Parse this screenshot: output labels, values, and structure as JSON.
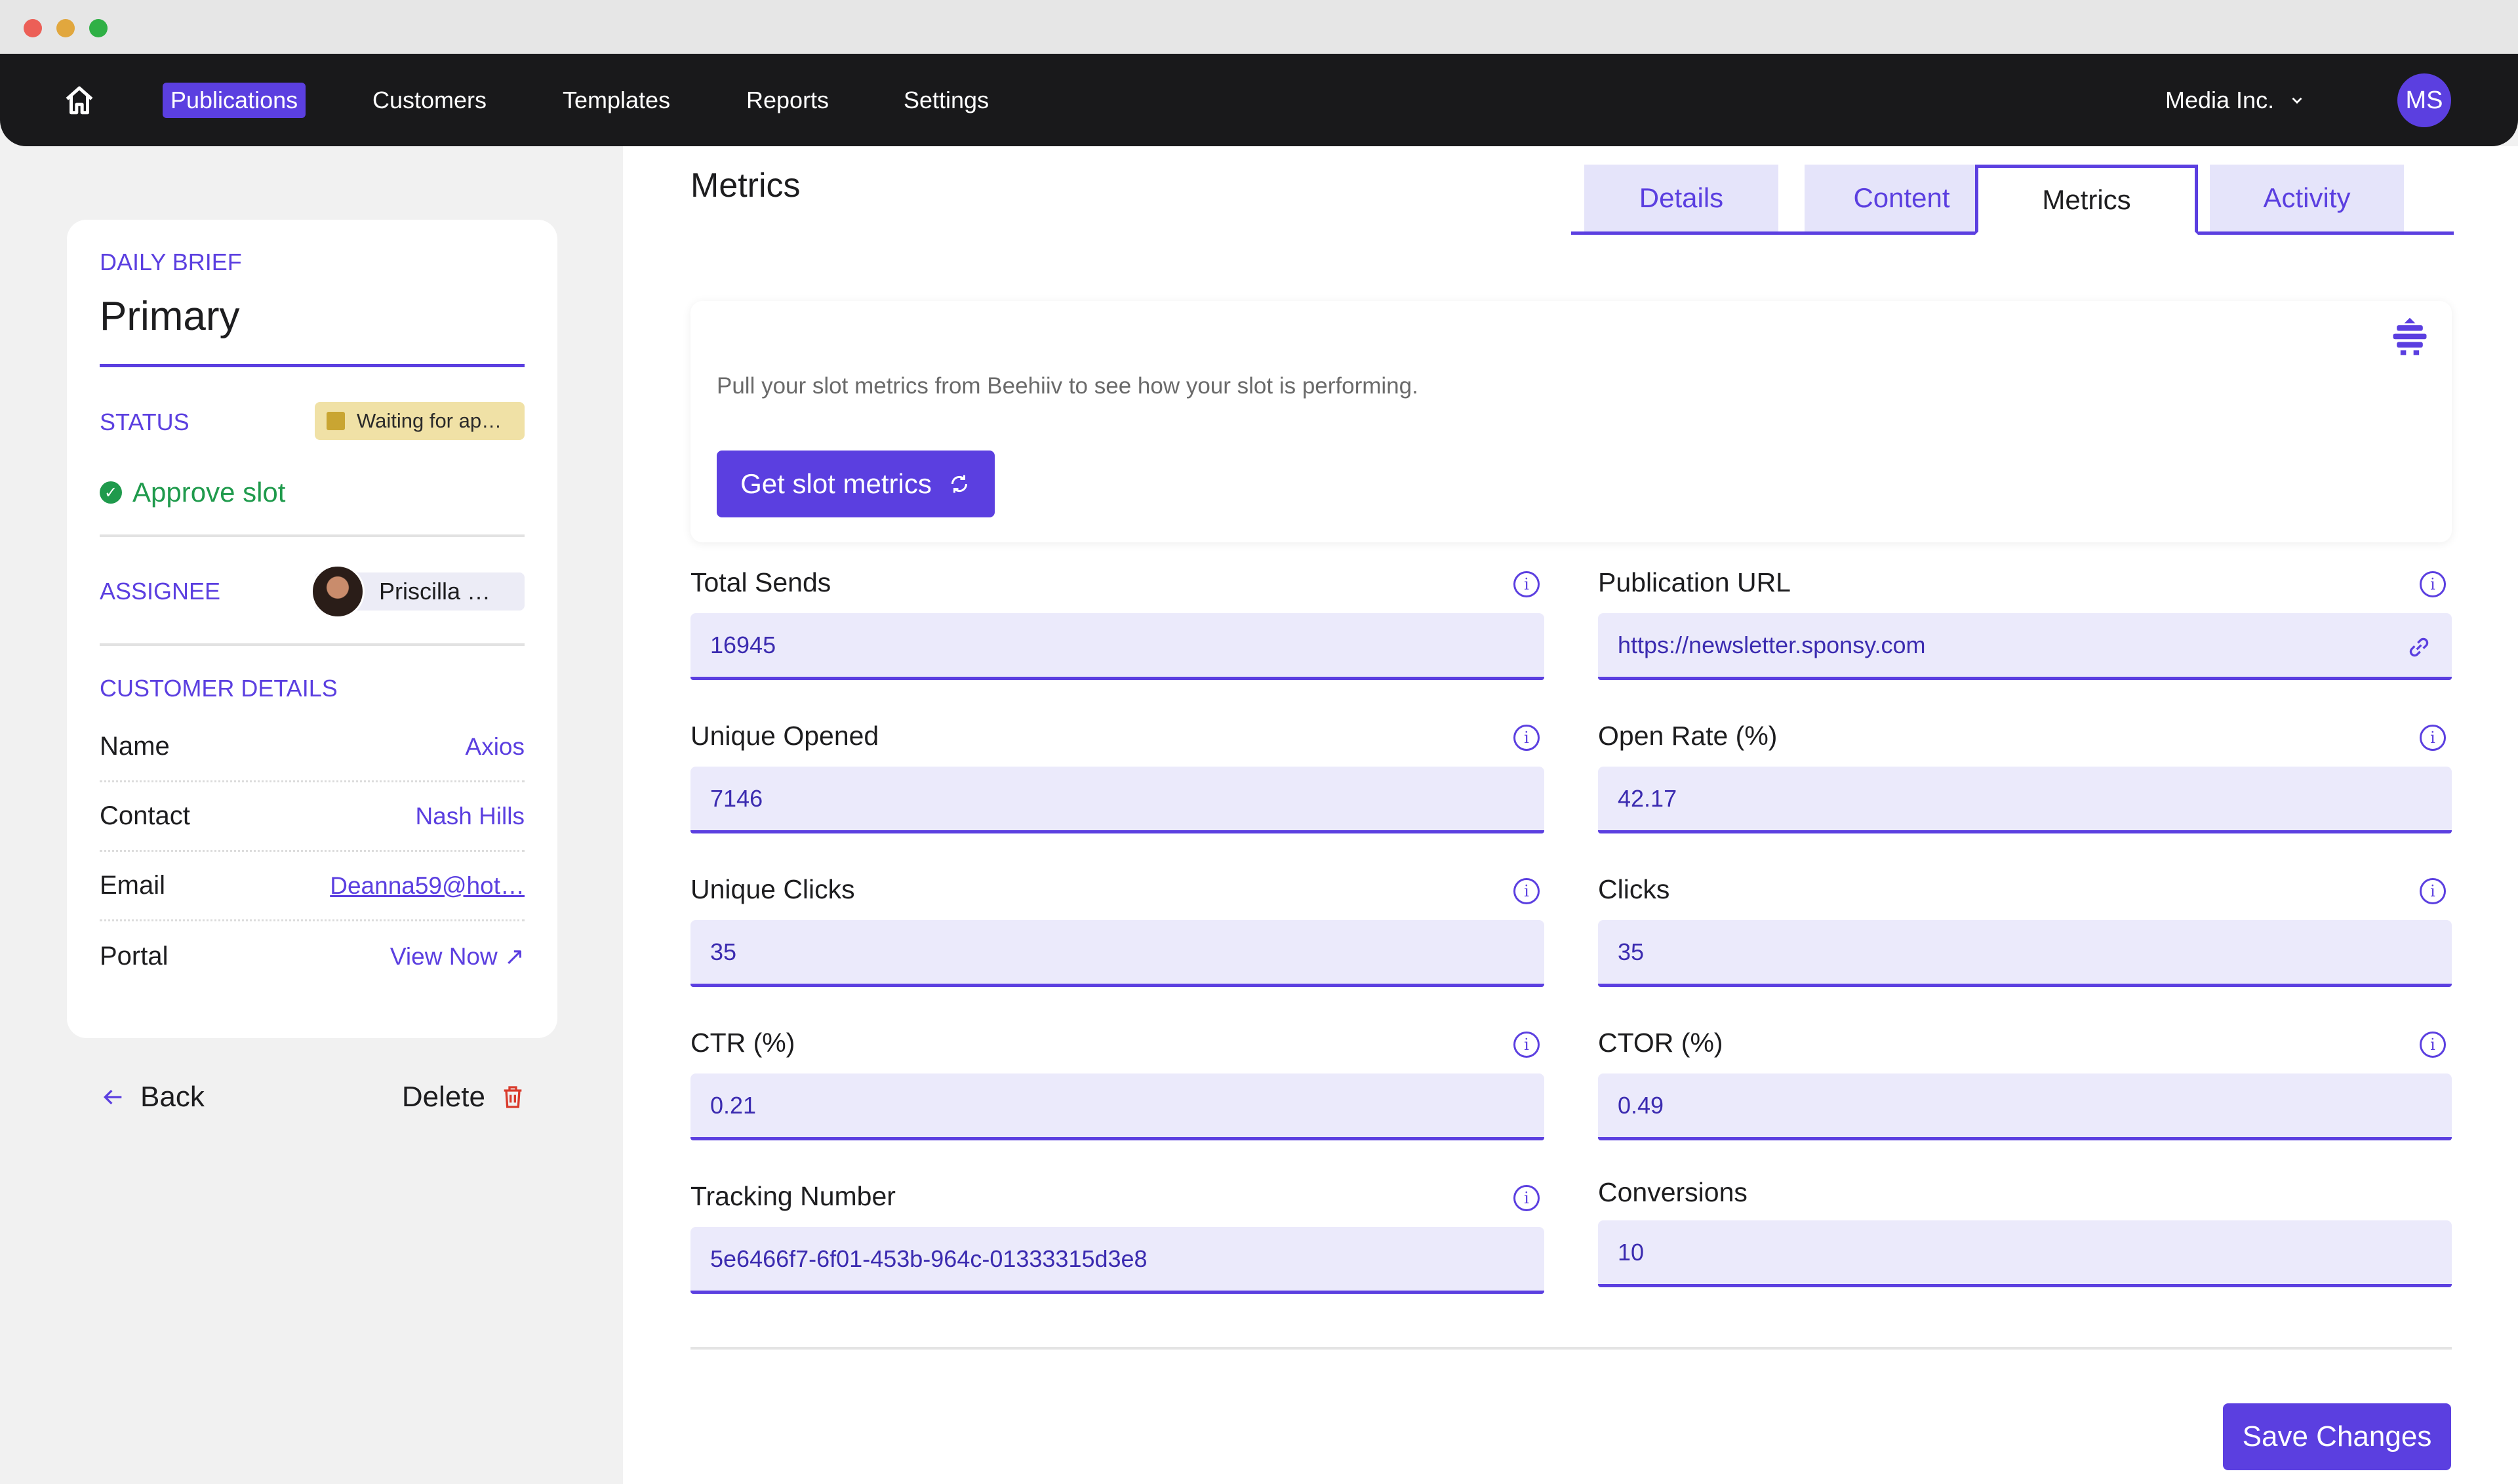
{
  "nav": {
    "items": [
      "Publications",
      "Customers",
      "Templates",
      "Reports",
      "Settings"
    ],
    "org": "Media Inc.",
    "user_initials": "MS"
  },
  "sidebar": {
    "category": "DAILY BRIEF",
    "title": "Primary",
    "status_label": "STATUS",
    "status_value": "Waiting for ap…",
    "approve": "Approve slot",
    "assignee_label": "ASSIGNEE",
    "assignee_name": "Priscilla …",
    "customer_label": "CUSTOMER DETAILS",
    "details": [
      {
        "key": "Name",
        "value": "Axios"
      },
      {
        "key": "Contact",
        "value": "Nash Hills"
      },
      {
        "key": "Email",
        "value": "Deanna59@hot…"
      },
      {
        "key": "Portal",
        "value": "View Now ↗"
      }
    ],
    "back": "Back",
    "delete": "Delete"
  },
  "main": {
    "title": "Metrics",
    "tabs": [
      "Details",
      "Content",
      "Metrics",
      "Activity"
    ],
    "active_tab": "Metrics",
    "beehiiv_text": "Pull your slot metrics from Beehiiv to see how your slot is performing.",
    "beehiiv_button": "Get slot metrics",
    "fields": {
      "total_sends": {
        "label": "Total Sends",
        "value": "16945"
      },
      "publication_url": {
        "label": "Publication URL",
        "value": "https://newsletter.sponsy.com"
      },
      "unique_opened": {
        "label": "Unique Opened",
        "value": "7146"
      },
      "open_rate": {
        "label": "Open Rate (%)",
        "value": "42.17"
      },
      "unique_clicks": {
        "label": "Unique Clicks",
        "value": "35"
      },
      "clicks": {
        "label": "Clicks",
        "value": "35"
      },
      "ctr": {
        "label": "CTR (%)",
        "value": "0.21"
      },
      "ctor": {
        "label": "CTOR (%)",
        "value": "0.49"
      },
      "tracking_number": {
        "label": "Tracking Number",
        "value": "5e6466f7-6f01-453b-964c-01333315d3e8"
      },
      "conversions": {
        "label": "Conversions",
        "value": "10"
      }
    },
    "save": "Save Changes"
  },
  "colors": {
    "accent": "#5b3fe0",
    "nav_bg": "#19191b",
    "input_bg": "#ebeafb",
    "status_bg": "#f0e1a6",
    "success": "#1f9a4c",
    "danger": "#d93a2b"
  }
}
